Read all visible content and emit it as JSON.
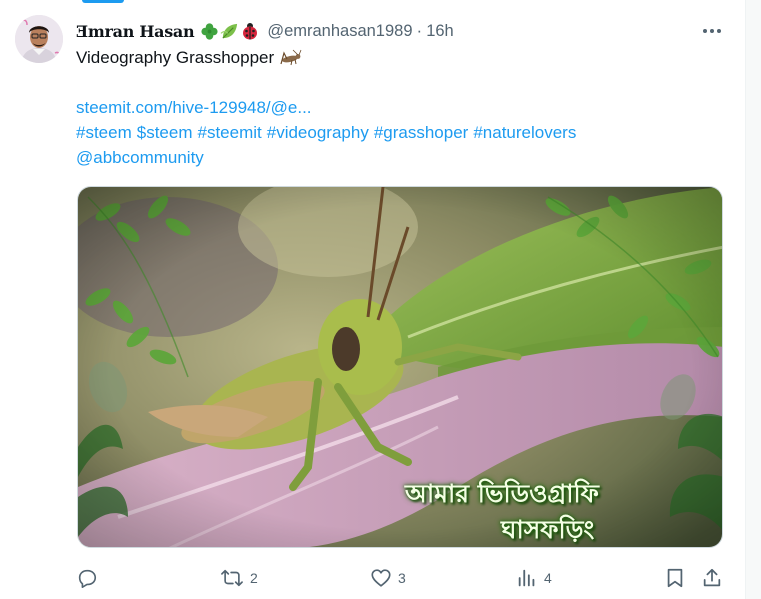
{
  "tweet": {
    "author": {
      "display_name": "Ǝmran Hasan",
      "badge_icons": [
        "shamrock-icon",
        "leaf-icon",
        "ladybug-icon"
      ],
      "handle": "@emranhasan1989",
      "separator": "·",
      "time": "16h"
    },
    "text": {
      "line1": "Videography Grasshopper",
      "link": "steemit.com/hive-129948/@e...",
      "hashtags": [
        "#steem",
        "$steem",
        "#steemit",
        "#videography",
        "#grasshoper",
        "#naturelovers"
      ],
      "mention": "@abbcommunity"
    },
    "media": {
      "overlay_line1": "আমার ভিডিওগ্রাফি",
      "overlay_line2": "ঘাসফড়িং"
    },
    "actions": {
      "reply_count": "",
      "retweet_count": "2",
      "like_count": "3",
      "views_count": "4"
    }
  },
  "colors": {
    "link": "#1d9bf0",
    "secondary_text": "#536471",
    "text": "#0f1419"
  }
}
